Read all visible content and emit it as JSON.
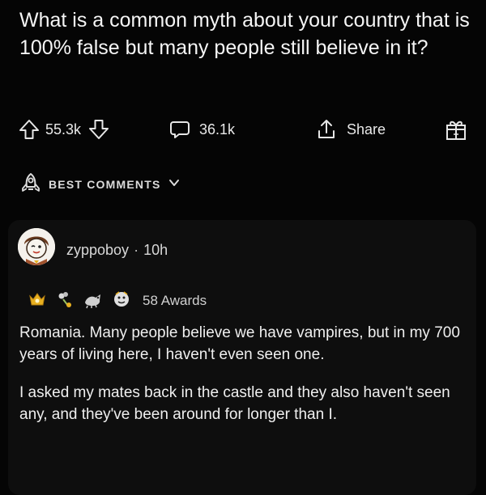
{
  "post": {
    "title": "What is a common myth about your country that is 100% false but many people still believe in it?"
  },
  "actions": {
    "upvotes": "55.3k",
    "comments": "36.1k",
    "share_label": "Share"
  },
  "sort": {
    "label": "BEST COMMENTS"
  },
  "comment": {
    "author": "zyppoboy",
    "separator": "·",
    "age": "10h",
    "awards_label": "58 Awards",
    "paragraphs": [
      "Romania. Many people believe we have vampires, but in my 700 years of living here, I haven't even seen one.",
      "I asked my mates back in the castle and they also haven't seen any, and they've been around for longer than I."
    ]
  },
  "icons": {
    "upvote": "arrow-up-icon",
    "downvote": "arrow-down-icon",
    "comment": "speech-bubble-icon",
    "share": "share-icon",
    "gift": "gift-icon",
    "sort": "rocket-icon",
    "chevron": "chevron-down-icon"
  },
  "colors": {
    "background": "#050505",
    "card": "#0e0e0e",
    "text": "#f2f2f2",
    "award_gold": "#e8b020"
  }
}
